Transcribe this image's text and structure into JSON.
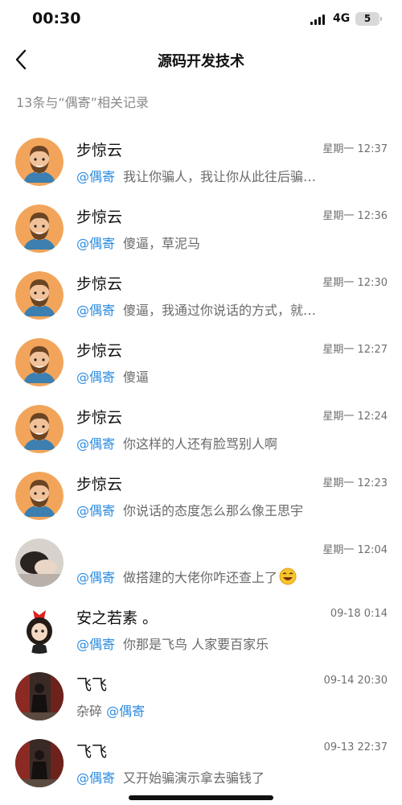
{
  "status": {
    "time": "00:30",
    "network": "4G",
    "battery": "5"
  },
  "nav": {
    "title": "源码开发技术"
  },
  "summary": "13条与“偶寄”相关记录",
  "results": [
    {
      "avatar": "man-beard-avatar",
      "name": "步惊云",
      "time": "星期一 12:37",
      "prefix": "",
      "mention": "@偶寄",
      "text": "我让你骗人，我让你从此往后骗…",
      "emoji": ""
    },
    {
      "avatar": "man-beard-avatar",
      "name": "步惊云",
      "time": "星期一 12:36",
      "prefix": "",
      "mention": "@偶寄",
      "text": "傻逼，草泥马",
      "emoji": ""
    },
    {
      "avatar": "man-beard-avatar",
      "name": "步惊云",
      "time": "星期一 12:30",
      "prefix": "",
      "mention": "@偶寄",
      "text": "傻逼，我通过你说话的方式，就…",
      "emoji": ""
    },
    {
      "avatar": "man-beard-avatar",
      "name": "步惊云",
      "time": "星期一 12:27",
      "prefix": "",
      "mention": "@偶寄",
      "text": "傻逼",
      "emoji": ""
    },
    {
      "avatar": "man-beard-avatar",
      "name": "步惊云",
      "time": "星期一 12:24",
      "prefix": "",
      "mention": "@偶寄",
      "text": "你这样的人还有脸骂别人啊",
      "emoji": ""
    },
    {
      "avatar": "man-beard-avatar",
      "name": "步惊云",
      "time": "星期一 12:23",
      "prefix": "",
      "mention": "@偶寄",
      "text": "你说话的态度怎么那么像王思宇",
      "emoji": ""
    },
    {
      "avatar": "photo-avatar",
      "name": "",
      "time": "星期一 12:04",
      "prefix": "",
      "mention": "@偶寄",
      "text": "做搭建的大佬你咋还查上了",
      "emoji": "laughing-emoji"
    },
    {
      "avatar": "cartoon-girl-avatar",
      "name": "安之若素 。",
      "time": "09-18 0:14",
      "prefix": "",
      "mention": "@偶寄",
      "text": "你那是飞鸟 人家要百家乐",
      "emoji": ""
    },
    {
      "avatar": "dark-photo-avatar",
      "name": "飞飞",
      "time": "09-14 20:30",
      "prefix": "杂碎 ",
      "mention": "@偶寄",
      "text": "",
      "emoji": ""
    },
    {
      "avatar": "dark-photo-avatar",
      "name": "飞飞",
      "time": "09-13 22:37",
      "prefix": "",
      "mention": "@偶寄",
      "text": "又开始骗演示拿去骗钱了",
      "emoji": ""
    }
  ],
  "colors": {
    "mention": "#2f8de0",
    "avatar_bg": "#f0a050",
    "meta": "#8a8a8a"
  }
}
